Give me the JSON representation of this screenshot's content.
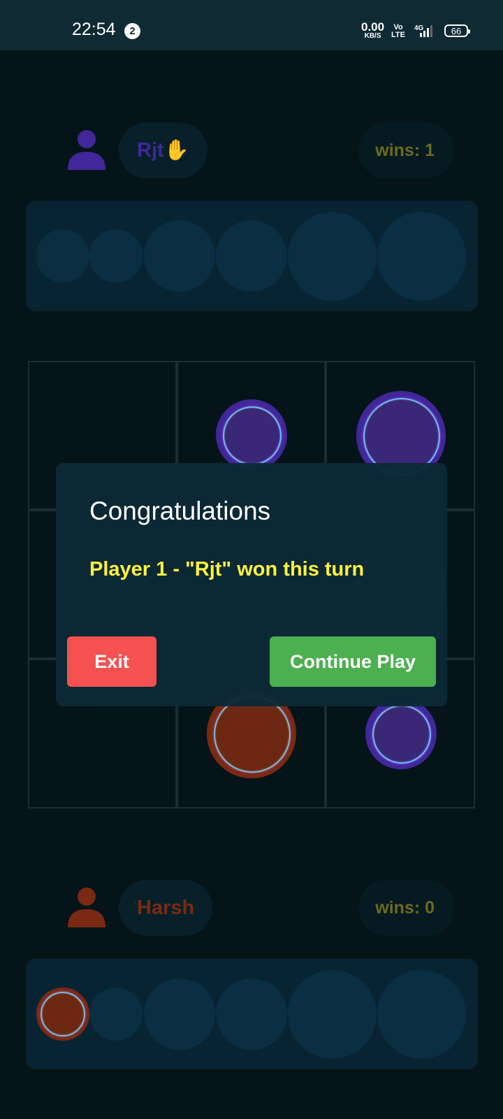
{
  "status_bar": {
    "time": "22:54",
    "notification_count": "2",
    "net_speed_value": "0.00",
    "net_speed_unit": "KB/S",
    "volte_top": "Vo",
    "volte_bottom": "LTE",
    "network": "4G",
    "battery": "66"
  },
  "player_top": {
    "name": "Rjt✋",
    "name_color": "#41279a",
    "wins_label": "wins: 1",
    "avatar_icon": "person-icon"
  },
  "player_bottom": {
    "name": "Harsh",
    "name_color": "#7a2a12",
    "wins_label": "wins: 0",
    "avatar_icon": "person-icon"
  },
  "dialog": {
    "title": "Congratulations",
    "message": "Player 1 - \"Rjt\" won this turn",
    "exit_label": "Exit",
    "continue_label": "Continue Play"
  },
  "colors": {
    "player1": "#41279a",
    "player2": "#7a2a12",
    "message": "#fff23b",
    "exit_button": "#f65151",
    "continue_button": "#4caf50"
  }
}
